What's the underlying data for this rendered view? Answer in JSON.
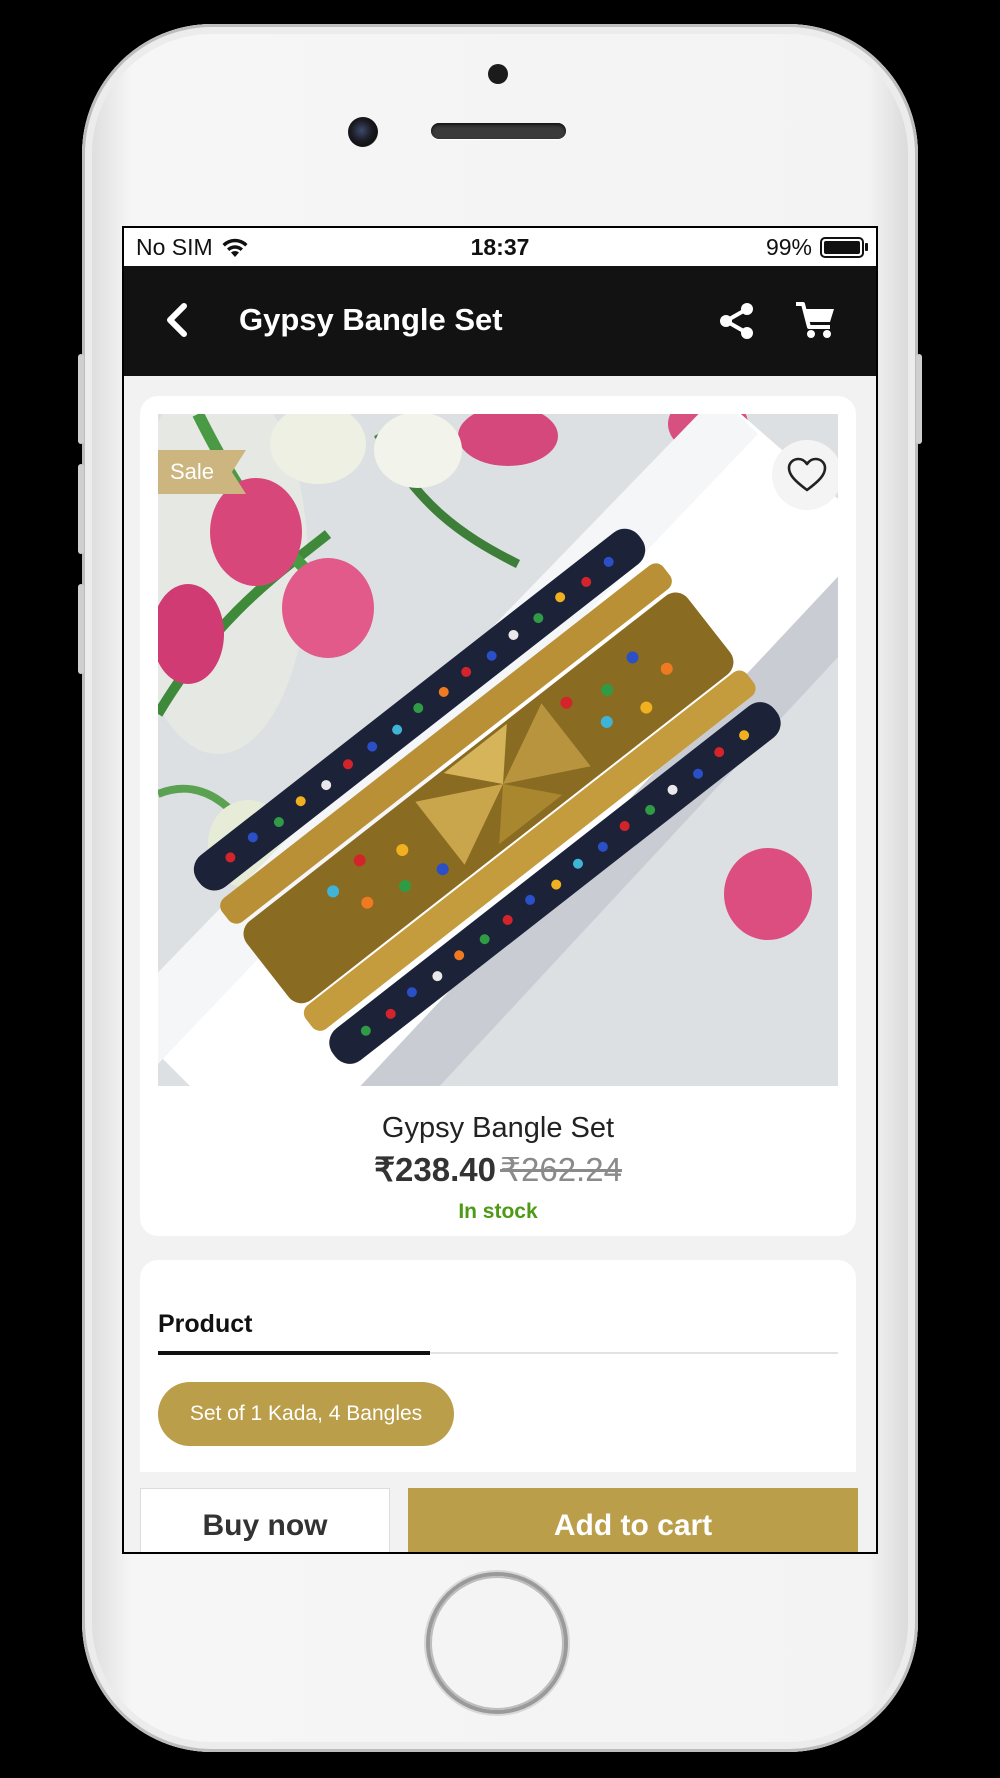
{
  "status_bar": {
    "carrier": "No SIM",
    "time": "18:37",
    "battery_percent": "99%",
    "battery_level": 0.99
  },
  "header": {
    "title": "Gypsy Bangle Set"
  },
  "product": {
    "badge": "Sale",
    "name": "Gypsy Bangle Set",
    "price": "₹238.40",
    "original_price": "₹262.24",
    "stock": "In stock"
  },
  "details": {
    "tab_label": "Product",
    "variant_chip": "Set of 1 Kada, 4 Bangles"
  },
  "actions": {
    "buy_now": "Buy now",
    "add_to_cart": "Add to cart"
  },
  "colors": {
    "accent": "#bb9e49",
    "badge": "#ccb57e",
    "stock_green": "#4c9a16",
    "header_bg": "#121212"
  }
}
